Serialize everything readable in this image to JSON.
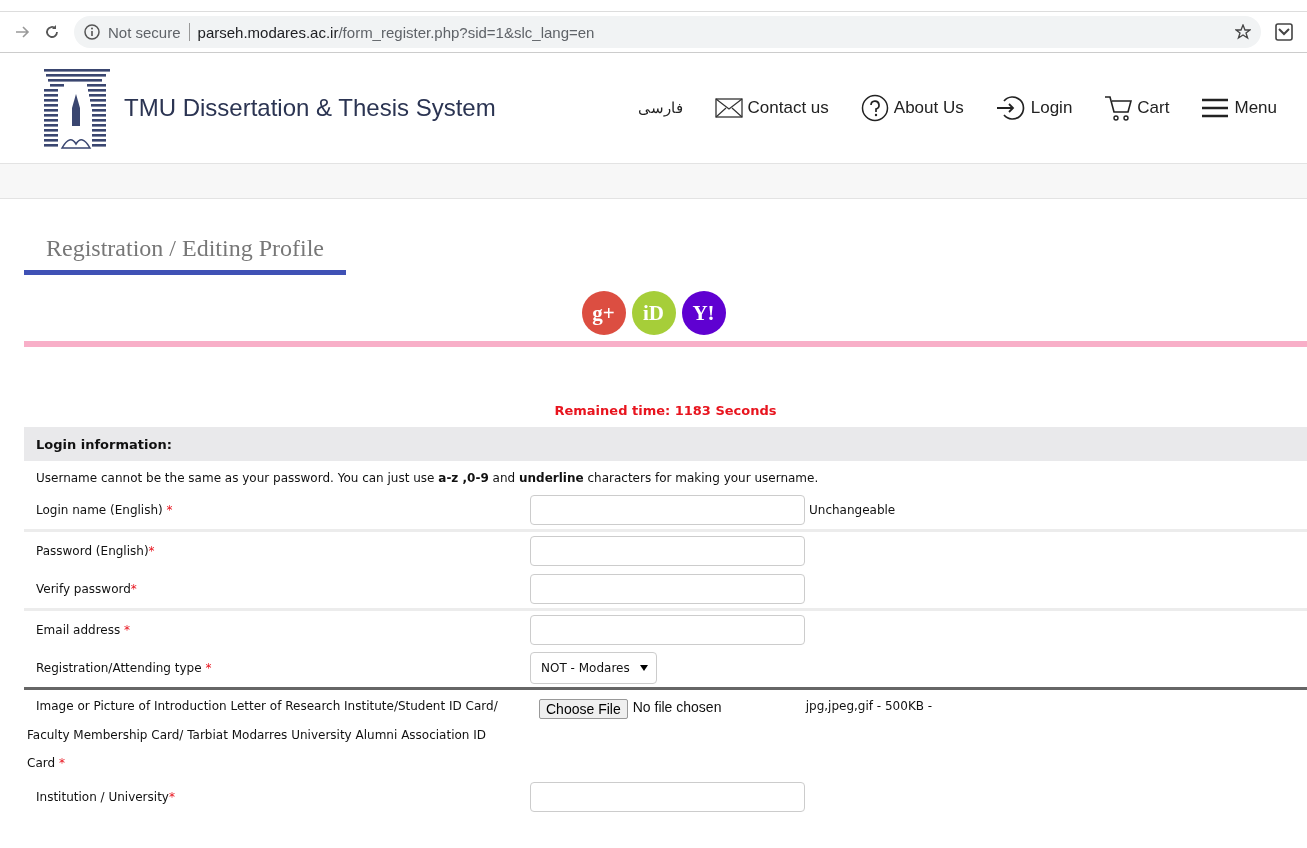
{
  "browser": {
    "security": "Not secure",
    "host": "parseh.modares.ac.ir",
    "path": "/form_register.php?sid=1&slc_lang=en"
  },
  "header": {
    "site_title": "TMU Dissertation & Thesis System",
    "nav": [
      {
        "kind": "lang",
        "label": "فارسی"
      },
      {
        "kind": "mail",
        "label": "Contact us"
      },
      {
        "kind": "help",
        "label": "About Us"
      },
      {
        "kind": "login",
        "label": "Login"
      },
      {
        "kind": "cart",
        "label": "Cart"
      },
      {
        "kind": "menu",
        "label": "Menu"
      }
    ]
  },
  "page_title": "Registration / Editing Profile",
  "social": [
    {
      "label": "g+",
      "color": "#dc4e41"
    },
    {
      "label": "iD",
      "color": "#a6ce39"
    },
    {
      "label": "Y!",
      "color": "#5f01d1"
    }
  ],
  "timer": "Remained time: 1183 Seconds",
  "form": {
    "section": "Login information:",
    "note": "Username cannot be the same as your password. You can just use **a-z ,0-9** and **underline** characters for making your username.",
    "groups": [
      {
        "divided": false,
        "rows": [
          {
            "kind": "input",
            "label": "Login name (English) ",
            "mark": "*",
            "after": "Unchangeable"
          }
        ]
      },
      {
        "divided": true,
        "dark": false,
        "rows": [
          {
            "kind": "input",
            "label": "Password (English)",
            "mark": "*"
          },
          {
            "kind": "input",
            "label": "Verify password",
            "mark": "*"
          }
        ]
      },
      {
        "divided": true,
        "dark": false,
        "rows": [
          {
            "kind": "input",
            "label": "Email address ",
            "mark": "*"
          },
          {
            "kind": "select",
            "label": "Registration/Attending type ",
            "mark": "*",
            "value": "NOT - Modares"
          }
        ]
      },
      {
        "divided": true,
        "dark": true,
        "rows": [
          {
            "kind": "file",
            "label": "Image or Picture of Introduction Letter of Research Institute/Student ID Card/ Faculty Membership Card/ Tarbiat Modarres University Alumni Association ID Card ",
            "mark": "*",
            "button": "Choose File",
            "status": "No file chosen",
            "hint": "jpg,jpeg,gif - 500KB -"
          },
          {
            "kind": "input",
            "label": "Institution / University",
            "mark": "*"
          }
        ]
      }
    ]
  }
}
